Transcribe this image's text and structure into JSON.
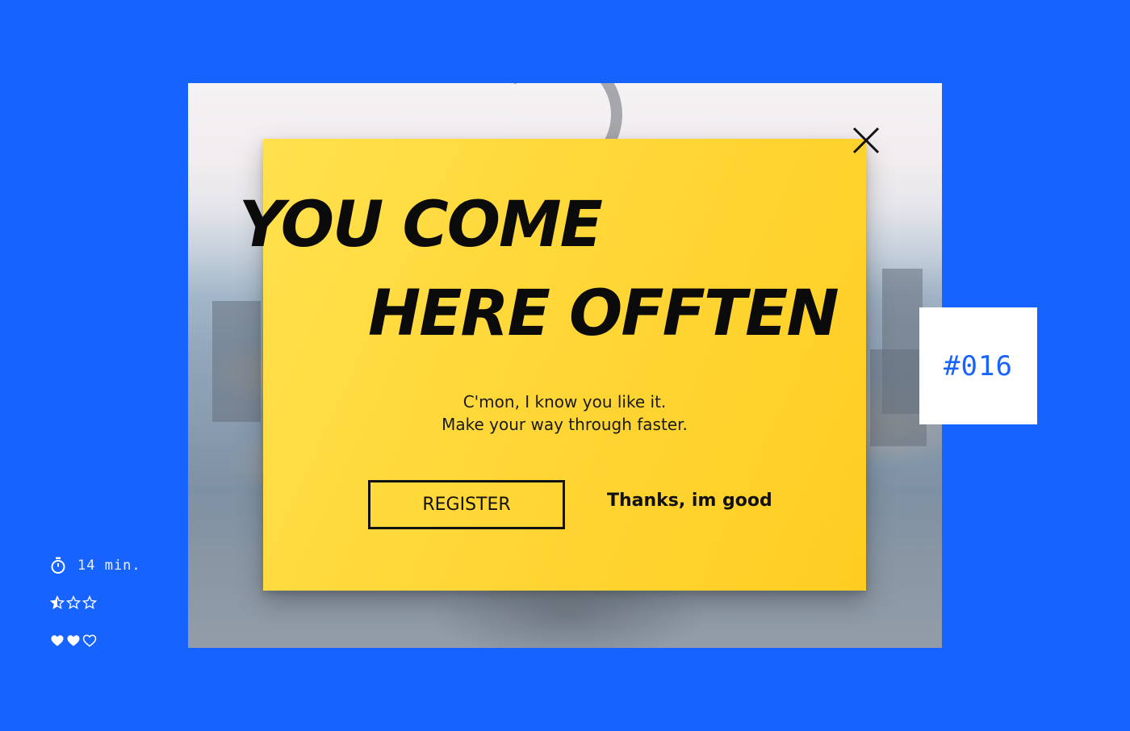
{
  "modal": {
    "headline_line1": "YOU COME",
    "headline_line2": "HERE OFFTEN",
    "subtext_line1": "C'mon, I know you like it.",
    "subtext_line2": "Make your way through faster.",
    "register_label": "REGISTER",
    "dismiss_label": "Thanks, im good",
    "close_icon": "close-icon"
  },
  "card": {
    "number": "#016"
  },
  "meta": {
    "time_icon": "stopwatch-icon",
    "time_label": "14 min.",
    "difficulty_rating": 0.5,
    "difficulty_max": 3,
    "likes": 2,
    "likes_max": 3
  },
  "colors": {
    "background": "#1763ff",
    "modal_yellow": "#ffd83a",
    "text_dark": "#111111",
    "card_text": "#1763ff"
  }
}
